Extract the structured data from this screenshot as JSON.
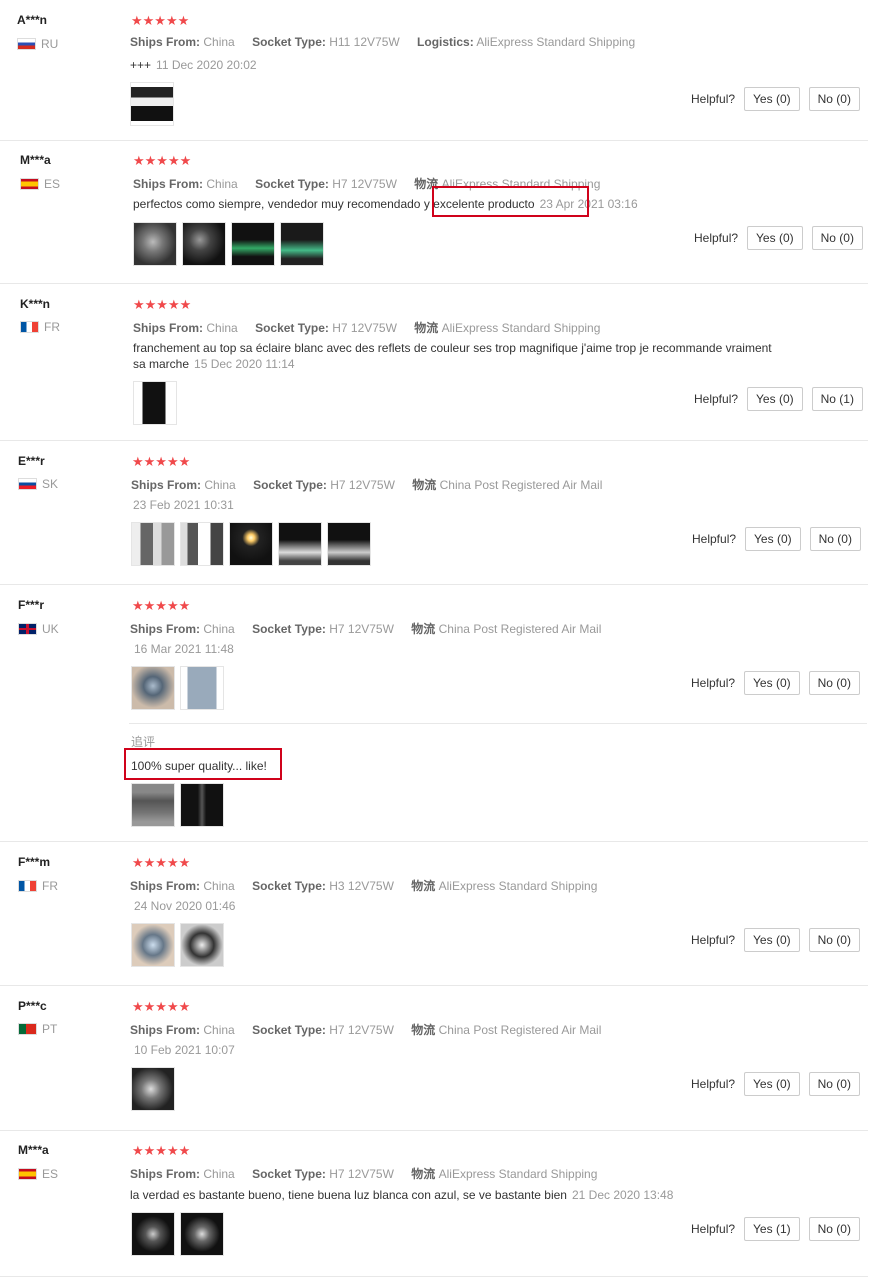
{
  "labels": {
    "ships_from": "Ships From:",
    "socket_type": "Socket Type:",
    "logistics": "Logistics:",
    "logistics_cn": "物流",
    "helpful": "Helpful?"
  },
  "reviews": [
    {
      "user": "A***n",
      "country": "RU",
      "stars": "★★★★★",
      "ships": "China",
      "socket": "H11 12V75W",
      "logistics_label": "Logistics:",
      "logistics": "AliExpress Standard Shipping",
      "text": "+++",
      "date": "11 Dec 2020 20:02",
      "yes": "Yes (0)",
      "no": "No (0)"
    },
    {
      "user": "M***a",
      "country": "ES",
      "stars": "★★★★★",
      "ships": "China",
      "socket": "H7 12V75W",
      "logistics_label": "物流",
      "logistics": "AliExpress Standard Shipping",
      "text": "perfectos como siempre, vendedor muy recomendado y excelente producto",
      "date": "23 Apr 2021 03:16",
      "yes": "Yes (0)",
      "no": "No (0)"
    },
    {
      "user": "K***n",
      "country": "FR",
      "stars": "★★★★★",
      "ships": "China",
      "socket": "H7 12V75W",
      "logistics_label": "物流",
      "logistics": "AliExpress Standard Shipping",
      "text": "franchement au top sa éclaire blanc avec des reflets de couleur ses trop magnifique j'aime trop je recommande vraiment sa marche",
      "date": "15 Dec 2020 11:14",
      "yes": "Yes (0)",
      "no": "No (1)"
    },
    {
      "user": "E***r",
      "country": "SK",
      "stars": "★★★★★",
      "ships": "China",
      "socket": "H7 12V75W",
      "logistics_label": "物流",
      "logistics": "China Post Registered Air Mail",
      "text": "",
      "date": "23 Feb 2021 10:31",
      "yes": "Yes (0)",
      "no": "No (0)"
    },
    {
      "user": "F***r",
      "country": "UK",
      "stars": "★★★★★",
      "ships": "China",
      "socket": "H7 12V75W",
      "logistics_label": "物流",
      "logistics": "China Post Registered Air Mail",
      "text": "",
      "date": "16 Mar 2021 11:48",
      "yes": "Yes (0)",
      "no": "No (0)",
      "followup_label": "追评",
      "followup_text": "100% super quality... like!"
    },
    {
      "user": "F***m",
      "country": "FR",
      "stars": "★★★★★",
      "ships": "China",
      "socket": "H3 12V75W",
      "logistics_label": "物流",
      "logistics": "AliExpress Standard Shipping",
      "text": "",
      "date": "24 Nov 2020 01:46",
      "yes": "Yes (0)",
      "no": "No (0)"
    },
    {
      "user": "P***c",
      "country": "PT",
      "stars": "★★★★★",
      "ships": "China",
      "socket": "H7 12V75W",
      "logistics_label": "物流",
      "logistics": "China Post Registered Air Mail",
      "text": "",
      "date": "10 Feb 2021 10:07",
      "yes": "Yes (0)",
      "no": "No (0)"
    },
    {
      "user": "M***a",
      "country": "ES",
      "stars": "★★★★★",
      "ships": "China",
      "socket": "H7 12V75W",
      "logistics_label": "物流",
      "logistics": "AliExpress Standard Shipping",
      "text": "la verdad es bastante bueno, tiene buena luz blanca con azul, se ve bastante bien",
      "date": "21 Dec 2020 13:48",
      "yes": "Yes (1)",
      "no": "No (0)"
    }
  ]
}
